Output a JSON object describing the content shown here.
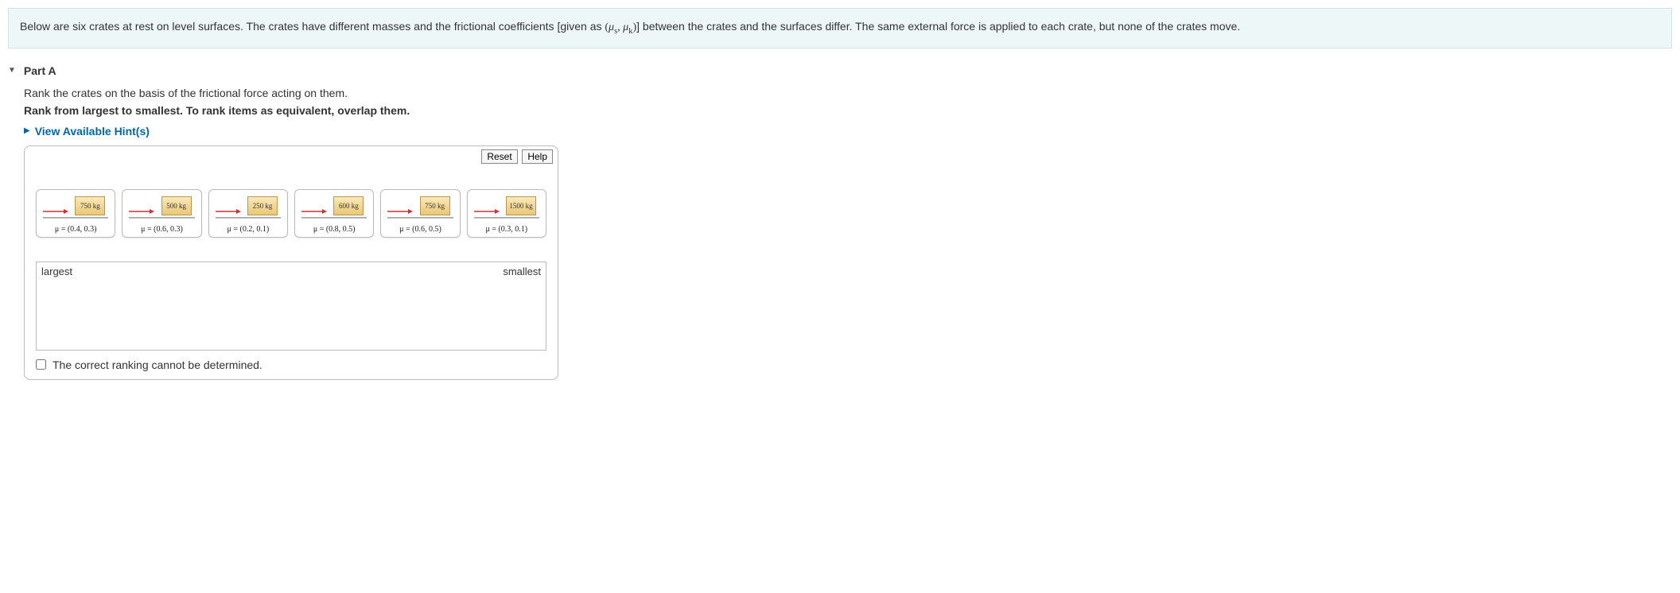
{
  "intro": {
    "before": "Below are six crates at rest on level surfaces. The crates have different masses and the frictional coefficients [given as ",
    "after": "] between the crates and the surfaces differ. The same external force is applied to each crate, but none of the crates move."
  },
  "part": {
    "label": "Part A",
    "line1": "Rank the crates on the basis of the frictional force acting on them.",
    "line2": "Rank from largest to smallest. To rank items as equivalent, overlap them.",
    "hint_link": "View Available Hint(s)"
  },
  "toolbar": {
    "reset": "Reset",
    "help": "Help"
  },
  "crates": [
    {
      "mass": "750 kg",
      "mu": "μ = (0.4, 0.3)"
    },
    {
      "mass": "500 kg",
      "mu": "μ = (0.6, 0.3)"
    },
    {
      "mass": "250 kg",
      "mu": "μ = (0.2, 0.1)"
    },
    {
      "mass": "600 kg",
      "mu": "μ = (0.8, 0.5)"
    },
    {
      "mass": "750 kg",
      "mu": "μ = (0.6, 0.5)"
    },
    {
      "mass": "1500 kg",
      "mu": "μ = (0.3, 0.1)"
    }
  ],
  "dropzone": {
    "left": "largest",
    "right": "smallest"
  },
  "cannot_determine": "The correct ranking cannot be determined."
}
